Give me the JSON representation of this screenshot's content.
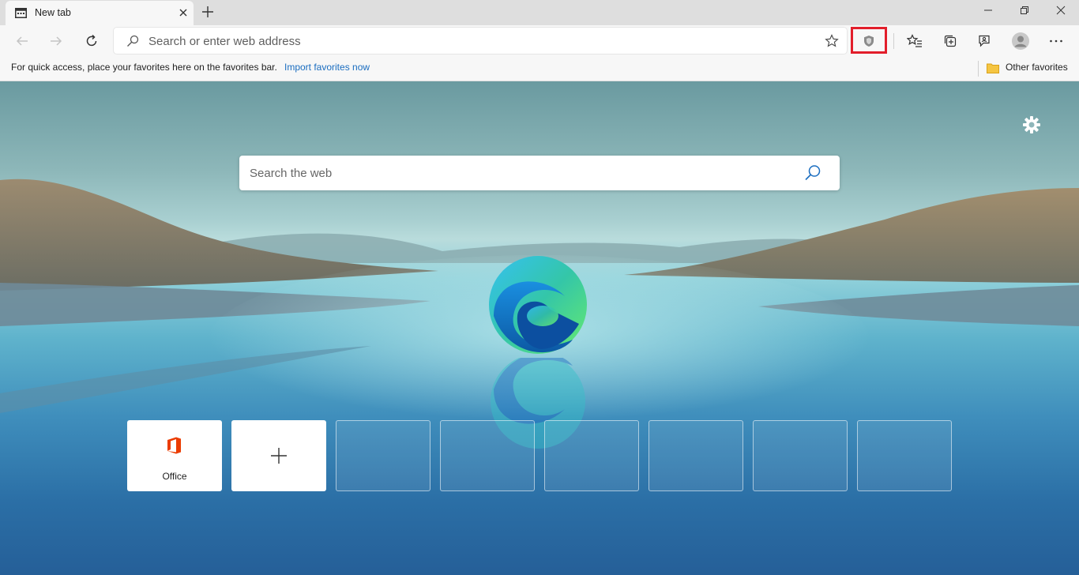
{
  "tab": {
    "title": "New tab"
  },
  "toolbar": {
    "address_placeholder": "Search or enter web address"
  },
  "favorites_bar": {
    "message": "For quick access, place your favorites here on the favorites bar.",
    "import_link": "Import favorites now",
    "other_favorites": "Other favorites"
  },
  "newtab": {
    "search_placeholder": "Search the web",
    "tiles": [
      {
        "label": "Office",
        "type": "site"
      },
      {
        "label": "",
        "type": "add"
      },
      {
        "label": "",
        "type": "empty"
      },
      {
        "label": "",
        "type": "empty"
      },
      {
        "label": "",
        "type": "empty"
      },
      {
        "label": "",
        "type": "empty"
      },
      {
        "label": "",
        "type": "empty"
      },
      {
        "label": "",
        "type": "empty"
      }
    ]
  },
  "colors": {
    "highlight": "#e21e2b",
    "link": "#1a6dc0",
    "office": "#eb3c00"
  },
  "icons": [
    "newtab-favicon-icon",
    "close-icon",
    "plus-icon",
    "minimize-icon",
    "restore-icon",
    "window-close-icon",
    "back-arrow-icon",
    "forward-arrow-icon",
    "refresh-icon",
    "search-icon",
    "star-icon",
    "shield-icon",
    "favorites-icon",
    "collections-icon",
    "feedback-icon",
    "profile-icon",
    "more-icon",
    "folder-icon",
    "gear-icon",
    "edge-logo-icon",
    "office-icon"
  ]
}
